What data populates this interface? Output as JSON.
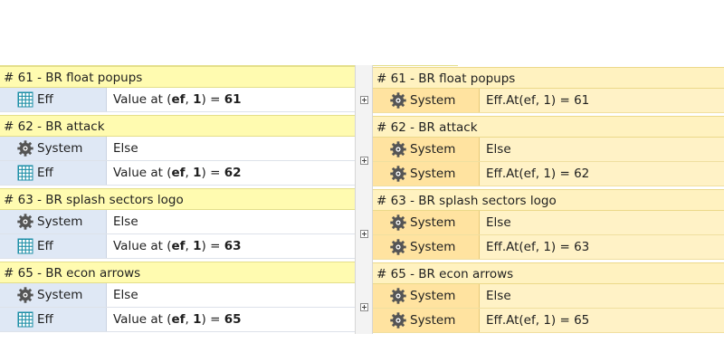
{
  "left": {
    "groups": [
      {
        "title": "# 61 - BR float popups",
        "rows": [
          {
            "icon": "grid-icon",
            "object": "Eff",
            "text": [
              "Value at (",
              "ef",
              ", ",
              "1",
              ") = ",
              "61"
            ]
          }
        ]
      },
      {
        "title": "# 62 - BR attack",
        "rows": [
          {
            "icon": "gear-icon",
            "object": "System",
            "text": [
              "Else"
            ]
          },
          {
            "icon": "grid-icon",
            "object": "Eff",
            "text": [
              "Value at (",
              "ef",
              ", ",
              "1",
              ") = ",
              "62"
            ]
          }
        ]
      },
      {
        "title": "# 63 - BR splash sectors logo",
        "rows": [
          {
            "icon": "gear-icon",
            "object": "System",
            "text": [
              "Else"
            ]
          },
          {
            "icon": "grid-icon",
            "object": "Eff",
            "text": [
              "Value at (",
              "ef",
              ", ",
              "1",
              ") = ",
              "63"
            ]
          }
        ]
      },
      {
        "title": "# 65 - BR econ arrows",
        "rows": [
          {
            "icon": "gear-icon",
            "object": "System",
            "text": [
              "Else"
            ]
          },
          {
            "icon": "grid-icon",
            "object": "Eff",
            "text": [
              "Value at (",
              "ef",
              ", ",
              "1",
              ") = ",
              "65"
            ]
          }
        ]
      }
    ]
  },
  "right": {
    "groups": [
      {
        "title": "# 61 - BR float popups",
        "rows": [
          {
            "icon": "gear-icon",
            "object": "System",
            "text": [
              "Eff.At(ef, 1) = 61"
            ]
          }
        ]
      },
      {
        "title": "# 62 - BR attack",
        "rows": [
          {
            "icon": "gear-icon",
            "object": "System",
            "text": [
              "Else"
            ]
          },
          {
            "icon": "gear-icon",
            "object": "System",
            "text": [
              "Eff.At(ef, 1) = 62"
            ]
          }
        ]
      },
      {
        "title": "# 63 - BR splash sectors logo",
        "rows": [
          {
            "icon": "gear-icon",
            "object": "System",
            "text": [
              "Else"
            ]
          },
          {
            "icon": "gear-icon",
            "object": "System",
            "text": [
              "Eff.At(ef, 1) = 63"
            ]
          }
        ]
      },
      {
        "title": "# 65 - BR econ arrows",
        "rows": [
          {
            "icon": "gear-icon",
            "object": "System",
            "text": [
              "Else"
            ]
          },
          {
            "icon": "gear-icon",
            "object": "System",
            "text": [
              "Eff.At(ef, 1) = 65"
            ]
          }
        ]
      }
    ]
  }
}
